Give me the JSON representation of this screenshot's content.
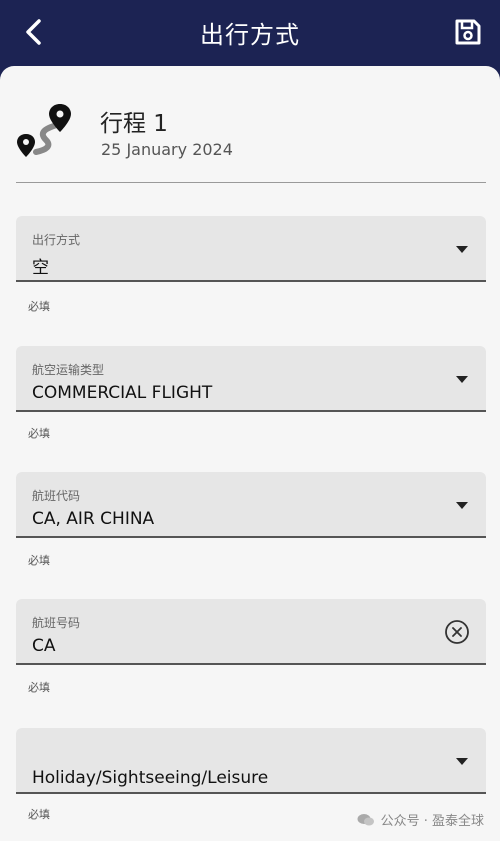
{
  "header": {
    "title": "出行方式",
    "back_icon": "chevron-left-icon",
    "save_icon": "save-icon"
  },
  "trip": {
    "title": "行程 1",
    "date": "25 January 2024",
    "icon": "route-icon"
  },
  "fields": [
    {
      "label": "出行方式",
      "value": "空",
      "control": "dropdown",
      "helper": "必填"
    },
    {
      "label": "航空运输类型",
      "value": "COMMERCIAL FLIGHT",
      "control": "dropdown",
      "helper": "必填"
    },
    {
      "label": "航班代码",
      "value": "CA, AIR CHINA",
      "control": "dropdown",
      "helper": "必填"
    },
    {
      "label": "航班号码",
      "value": "CA",
      "control": "clearable-input",
      "helper": "必填"
    },
    {
      "label": "",
      "value": "Holiday/Sightseeing/Leisure",
      "control": "dropdown",
      "helper": "必填"
    }
  ],
  "watermark": {
    "text": "公众号 · 盈泰全球"
  },
  "colors": {
    "header_bg": "#1c2353",
    "field_bg": "#e6e6e6",
    "sheet_bg": "#f6f6f6"
  }
}
